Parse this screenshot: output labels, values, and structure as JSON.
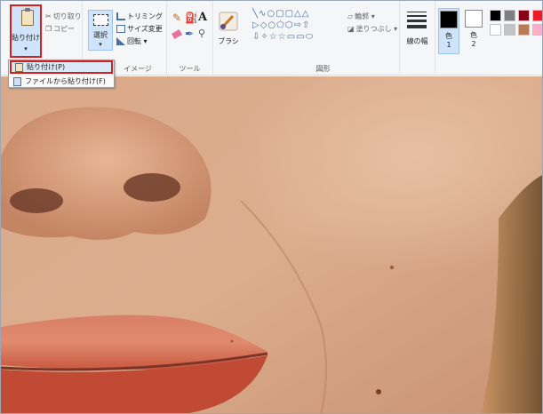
{
  "ribbon": {
    "clipboard": {
      "paste_label": "貼り付け",
      "paste_arrow": "▾",
      "cut_label": "切り取り",
      "copy_label": "コピー"
    },
    "image": {
      "select_label": "選択",
      "select_arrow": "▾",
      "crop_label": "トリミング",
      "resize_label": "サイズ変更",
      "rotate_label": "回転 ▾",
      "group_label": "イメージ"
    },
    "tools": {
      "group_label": "ツール"
    },
    "brushes": {
      "label": "ブラシ"
    },
    "shapes": {
      "row1": "╲∿○▢▢△△",
      "row2": "▷◇○⬠⬡⇨⇧",
      "row3": "⇩✧☆☆▭▭⬭",
      "outline_label": "輪郭 ▾",
      "fill_label": "塗りつぶし ▾",
      "group_label": "図形"
    },
    "size": {
      "label": "線の幅"
    },
    "colors": {
      "color1_label": "色",
      "color1_num": "1",
      "color2_label": "色",
      "color2_num": "2",
      "color1": "#000000",
      "color2": "#ffffff",
      "palette": [
        "#000000",
        "#7f7f7f",
        "#880015",
        "#ed1c24",
        "#ffffff",
        "#c3c3c3",
        "#b97a57",
        "#ffaec9"
      ]
    }
  },
  "paste_menu": {
    "item1": "貼り付け(P)",
    "item2": "ファイルから貼り付け(F)"
  },
  "colors": {
    "accent_selected": "#cfe4fa",
    "highlight_red": "#d51f1f"
  }
}
